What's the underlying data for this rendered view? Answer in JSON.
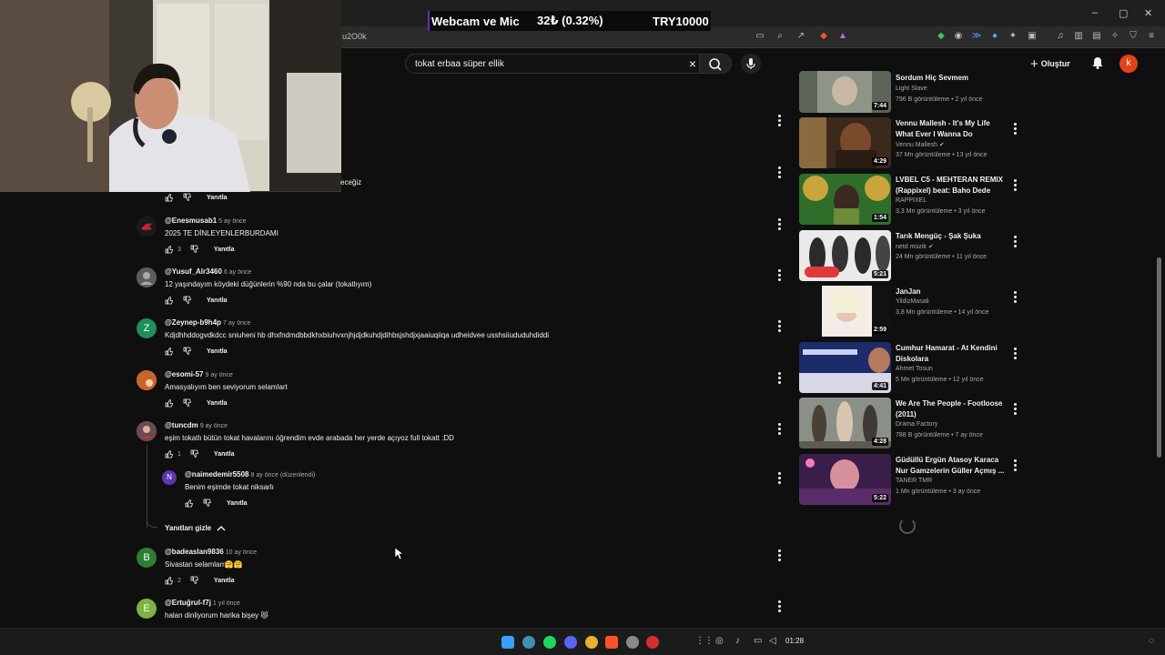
{
  "stream_overlay": {
    "label": "Webcam ve Mic",
    "amount": "32₺ (0.32%)",
    "goal": "TRY10000"
  },
  "browser": {
    "url_fragment": "u2O0k"
  },
  "search": {
    "query": "tokat erbaa süper ellik",
    "clear_icon": "close-icon",
    "search_icon": "search-icon",
    "mic_icon": "mic-icon"
  },
  "header": {
    "create_label": "Oluştur",
    "avatar_letter": "k"
  },
  "partial_comment": {
    "text_tail": "eceğiz",
    "reply": "Yanıtla"
  },
  "comments": [
    {
      "author": "@Enesmusab1",
      "time": "5 ay önce",
      "text": "2025 TE DİNLEYENLERBURDAMI",
      "likes": "3",
      "reply": "Yanıtla",
      "avatar_color": "#1a1a1a"
    },
    {
      "author": "@Yusuf_Alr3460",
      "time": "6 ay önce",
      "text": "12 yaşındayım köydeki düğünlerin %90 nda bu çalar (tokatlıyım)",
      "likes": "",
      "reply": "Yanıtla",
      "avatar_color": "#6d6d6d"
    },
    {
      "author": "@Zeynep-b9h4p",
      "time": "7 ay önce",
      "text": "Kdjdhhddogvdkdcc sniuheni hb dhxfndmdbbdkhxbiuhvxnjhjdjdkuhdjdihbsjshdjxjaaiuqiiqa udheidvee usshsiiududuhdiddi",
      "likes": "",
      "reply": "Yanıtla",
      "avatar_color": "#1e8e5a",
      "avatar_letter": "Z"
    },
    {
      "author": "@esomi-57",
      "time": "9 ay önce",
      "text": "Amasyalıyım ben seviyorum selamlart",
      "likes": "",
      "reply": "Yanıtla",
      "avatar_color": "#c9652c"
    },
    {
      "author": "@tuncdm",
      "time": "9 ay önce",
      "text": "eşim tokatlı bütün tokat havalarını öğrendim evde arabada her yerde açıyoz full tokatt :DD",
      "likes": "1",
      "reply": "Yanıtla",
      "avatar_color": "#7a5b63"
    },
    {
      "author": "@badeaslan9836",
      "time": "10 ay önce",
      "text": "Sivastan selamlarr🤗🤗",
      "likes": "2",
      "reply": "Yanıtla",
      "avatar_color": "#2e7d32",
      "avatar_letter": "B"
    },
    {
      "author": "@Ertuğrul-f7j",
      "time": "1 yıl önce",
      "text": "halan dinliyorum harika bişey 😻",
      "likes": "",
      "reply": "Yanıtla",
      "avatar_color": "#7cb342",
      "avatar_letter": "E"
    }
  ],
  "reply_comment": {
    "author": "@naimedemir5508",
    "time": "8 ay önce (düzenlendi)",
    "text": "Benim eşimde tokat niksarlı",
    "reply": "Yanıtla",
    "avatar_color": "#5e35b1",
    "avatar_letter": "N"
  },
  "hide_replies": "Yanıtları gizle",
  "videos": [
    {
      "title": "Sordum Hiç Sevmem",
      "channel": "Light Slave",
      "verified": false,
      "meta": "796 B görüntüleme • 2 yıl önce",
      "duration": "7:44"
    },
    {
      "title": "Vennu Mallesh - It's My Life What Ever I Wanna Do",
      "channel": "Vennu Mallesh",
      "verified": true,
      "meta": "37 Mn görüntüleme • 13 yıl önce",
      "duration": "4:29"
    },
    {
      "title": "LVBEL C5 - MEHTERAN REMIX (Rappixel) beat: Baho Dede",
      "channel": "RAPPIXEL",
      "verified": false,
      "meta": "3,3 Mn görüntüleme • 3 yıl önce",
      "duration": "1:54"
    },
    {
      "title": "Tarık Mengüç - Şak Şuka",
      "channel": "netd müzik",
      "verified": true,
      "meta": "24 Mn görüntüleme • 11 yıl önce",
      "duration": "5:21"
    },
    {
      "title": "JanJan",
      "channel": "YildizMasali",
      "verified": false,
      "meta": "3,8 Mn görüntüleme • 14 yıl önce",
      "duration": "2:59"
    },
    {
      "title": "Cumhur Hamarat - At Kendini Diskolara",
      "channel": "Ahmet Tosun",
      "verified": false,
      "meta": "5 Mn görüntüleme • 12 yıl önce",
      "duration": "4:41"
    },
    {
      "title": "We Are The People - Footloose (2011)",
      "channel": "Drama Factory",
      "verified": false,
      "meta": "788 B görüntüleme • 7 ay önce",
      "duration": "4:28"
    },
    {
      "title": "Güdüllü Ergün Atasoy Karaca Nur Gamzelerin Güller Açmış ...",
      "channel": "TANER TMR",
      "verified": false,
      "meta": "1 Mn görüntüleme • 3 ay önce",
      "duration": "5:22"
    }
  ],
  "taskbar": {
    "clock": "01:28"
  }
}
